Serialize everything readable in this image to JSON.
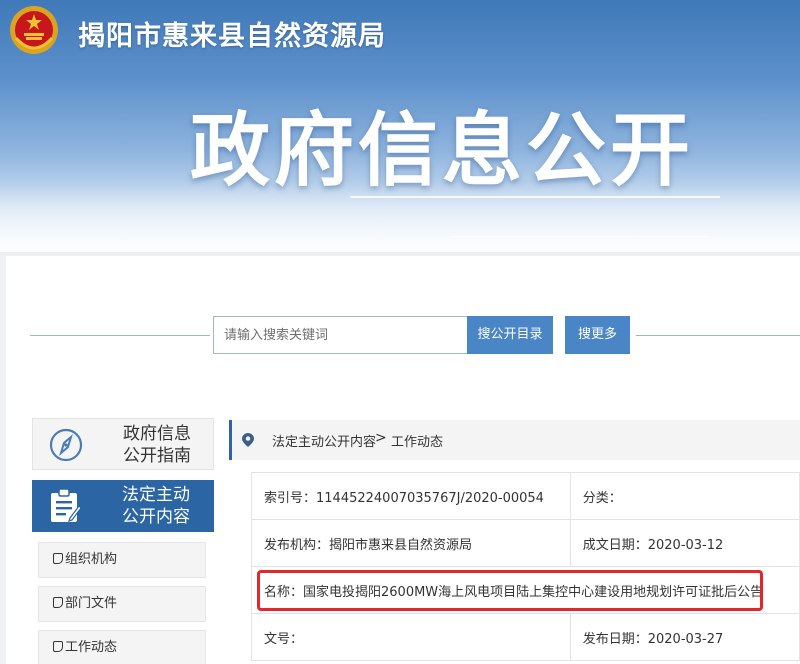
{
  "header": {
    "org_name": "揭阳市惠来县自然资源局",
    "big_title": "政府信息公开"
  },
  "search": {
    "placeholder": "请输入搜索关键词",
    "catalog_button": "搜公开目录",
    "more_button": "搜更多"
  },
  "sidebar": {
    "guide_label": "政府信息公开指南",
    "active_label": "法定主动公开内容",
    "items": [
      {
        "label": "组织机构"
      },
      {
        "label": "部门文件"
      },
      {
        "label": "工作动态"
      }
    ]
  },
  "breadcrumb": {
    "level1": "法定主动公开内容",
    "separator": ">",
    "level2": "工作动态"
  },
  "detail": {
    "index_no": "索引号：11445224007035767J/2020-00054",
    "category": "分类：",
    "publisher": "发布机构：揭阳市惠来县自然资源局",
    "written_date": "成文日期：2020-03-12",
    "name": "名称：国家电投揭阳2600MW海上风电项目陆上集控中心建设用地规划许可证批后公告",
    "doc_no": "文号：",
    "publish_date": "发布日期：2020-03-27"
  },
  "colors": {
    "primary": "#2b65a3",
    "button": "#4a86c6",
    "highlight": "#e3262b"
  },
  "icons": [
    "national-emblem-icon",
    "compass-icon",
    "clipboard-icon",
    "map-pin-icon"
  ]
}
